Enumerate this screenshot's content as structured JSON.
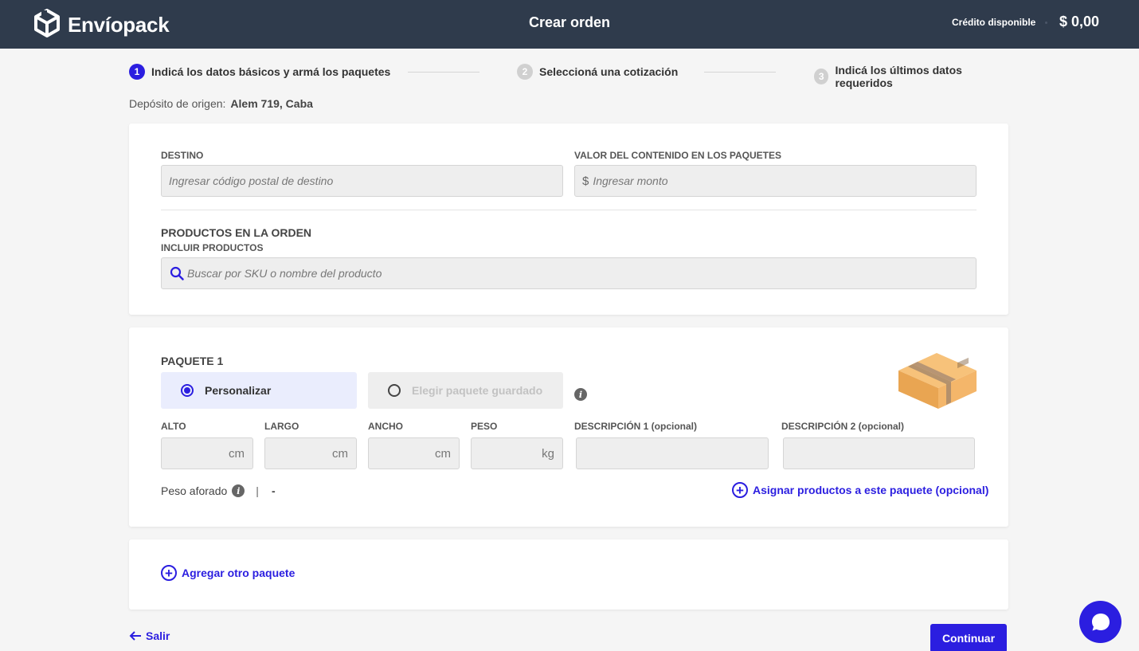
{
  "header": {
    "logo_text": "Envíopack",
    "title": "Crear orden",
    "credit_label": "Crédito disponible",
    "credit_value": "$ 0,00"
  },
  "steps": [
    {
      "num": "1",
      "label": "Indicá los datos básicos y armá los paquetes",
      "active": true
    },
    {
      "num": "2",
      "label": "Seleccioná una cotización",
      "active": false
    },
    {
      "num": "3",
      "label": "Indicá los últimos datos requeridos",
      "active": false
    }
  ],
  "origin": {
    "label": "Depósito de origen:",
    "value": "Alem 719, Caba"
  },
  "destination": {
    "label": "DESTINO",
    "placeholder": "Ingresar código postal de destino"
  },
  "content_value": {
    "label": "VALOR DEL CONTENIDO EN LOS PAQUETES",
    "prefix": "$",
    "placeholder": "Ingresar monto"
  },
  "products": {
    "title": "PRODUCTOS EN LA ORDEN",
    "label": "INCLUIR PRODUCTOS",
    "placeholder": "Buscar por SKU o nombre del producto"
  },
  "package": {
    "title": "PAQUETE 1",
    "option_custom": "Personalizar",
    "option_saved": "Elegir paquete guardado",
    "fields": {
      "alto": {
        "label": "ALTO",
        "unit": "cm"
      },
      "largo": {
        "label": "LARGO",
        "unit": "cm"
      },
      "ancho": {
        "label": "ANCHO",
        "unit": "cm"
      },
      "peso": {
        "label": "PESO",
        "unit": "kg"
      },
      "desc1": {
        "label": "DESCRIPCIÓN 1 (opcional)"
      },
      "desc2": {
        "label": "DESCRIPCIÓN 2 (opcional)"
      }
    },
    "volumetric_label": "Peso aforado",
    "volumetric_sep": "|",
    "volumetric_value": "-",
    "assign_link": "Asignar productos a este paquete (opcional)"
  },
  "add_package": "Agregar otro paquete",
  "footer": {
    "exit": "Salir",
    "continue": "Continuar"
  },
  "colors": {
    "accent": "#2b1ee0",
    "topbar": "#2f3b4c"
  }
}
